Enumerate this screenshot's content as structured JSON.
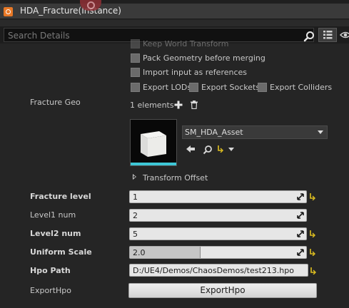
{
  "window": {
    "title": "HDA_Fracture(Instance)"
  },
  "search": {
    "placeholder": "Search Details"
  },
  "options": {
    "keep_world_transform": "Keep World Transform",
    "pack_geometry": "Pack Geometry before merging",
    "import_as_references": "Import input as references",
    "export_lods": "Export LODs",
    "export_sockets": "Export Sockets",
    "export_colliders": "Export Colliders"
  },
  "fracture_geo": {
    "label": "Fracture Geo",
    "elements_count": "1 elements",
    "asset_name": "SM_HDA_Asset",
    "transform_offset": "Transform Offset"
  },
  "params": {
    "fracture_level": {
      "label": "Fracture level",
      "value": "1"
    },
    "level1_num": {
      "label": "Level1 num",
      "value": "2"
    },
    "level2_num": {
      "label": "Level2 num",
      "value": "5"
    },
    "uniform_scale": {
      "label": "Uniform Scale",
      "value": "2.0",
      "slider_fraction": 0.4
    },
    "hpo_path": {
      "label": "Hpo Path",
      "value": "D:/UE4/Demos/ChaosDemos/test213.hpo"
    },
    "export_hpo": {
      "label": "ExportHpo",
      "button_label": "ExportHpo"
    }
  },
  "colors": {
    "reset_arrow": "#e0c020",
    "thumbnail_accent": "#3ec7d6",
    "houdini_orange": "#e87826"
  }
}
